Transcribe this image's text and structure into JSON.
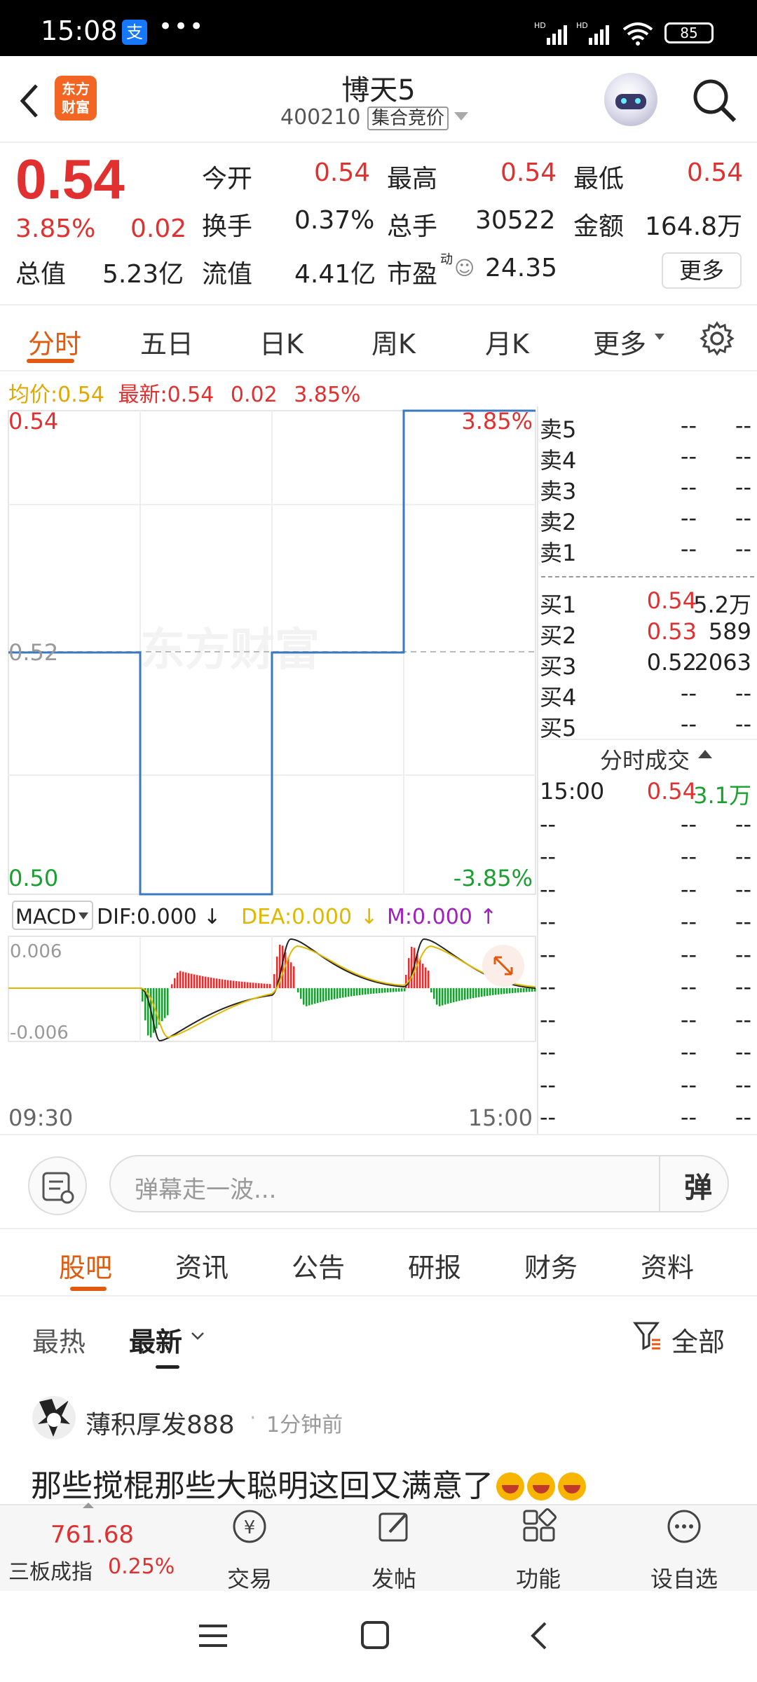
{
  "status_bar": {
    "time": "15:08",
    "app_badge": "支",
    "more": "•••",
    "battery": "85"
  },
  "header": {
    "title": "博天5",
    "code": "400210",
    "tag": "集合竞价",
    "logo_line1": "东方",
    "logo_line2": "财富"
  },
  "quote": {
    "price": "0.54",
    "change_pct": "3.85%",
    "change": "0.02",
    "open_label": "今开",
    "open": "0.54",
    "high_label": "最高",
    "high": "0.54",
    "low_label": "最低",
    "low": "0.54",
    "turnover_label": "换手",
    "turnover": "0.37%",
    "volume_label": "总手",
    "volume": "30522",
    "amount_label": "金额",
    "amount": "164.8万",
    "mktcap_label": "总值",
    "mktcap": "5.23亿",
    "float_label": "流值",
    "float": "4.41亿",
    "pe_label": "市盈",
    "pe_sup": "动",
    "pe": "24.35",
    "more_button": "更多"
  },
  "tabs": [
    "分时",
    "五日",
    "日K",
    "周K",
    "月K",
    "更多"
  ],
  "legend": {
    "avg_label": "均价:",
    "avg": "0.54",
    "last_label": "最新:",
    "last": "0.54",
    "chg": "0.02",
    "pct": "3.85%"
  },
  "chart_labels": {
    "top": "0.54",
    "mid": "0.52",
    "bottom": "0.50",
    "top_pct": "3.85%",
    "bottom_pct": "-3.85%",
    "time_start": "09:30",
    "time_end": "15:00",
    "watermark": "东方财富"
  },
  "macd": {
    "name": "MACD",
    "dif": "DIF:0.000",
    "dea": "DEA:0.000",
    "m": "M:0.000",
    "top": "0.006",
    "bottom": "-0.006"
  },
  "order_book": {
    "asks": [
      {
        "label": "卖5",
        "price": "--",
        "vol": "--"
      },
      {
        "label": "卖4",
        "price": "--",
        "vol": "--"
      },
      {
        "label": "卖3",
        "price": "--",
        "vol": "--"
      },
      {
        "label": "卖2",
        "price": "--",
        "vol": "--"
      },
      {
        "label": "卖1",
        "price": "--",
        "vol": "--"
      }
    ],
    "bids": [
      {
        "label": "买1",
        "price": "0.54",
        "vol": "5.2万"
      },
      {
        "label": "买2",
        "price": "0.53",
        "vol": "589"
      },
      {
        "label": "买3",
        "price": "0.52",
        "vol": "2063"
      },
      {
        "label": "买4",
        "price": "--",
        "vol": "--"
      },
      {
        "label": "买5",
        "price": "--",
        "vol": "--"
      }
    ],
    "trades_title": "分时成交",
    "trades": [
      {
        "time": "15:00",
        "price": "0.54",
        "vol": "3.1万"
      },
      {
        "time": "--",
        "price": "--",
        "vol": "--"
      },
      {
        "time": "--",
        "price": "--",
        "vol": "--"
      },
      {
        "time": "--",
        "price": "--",
        "vol": "--"
      },
      {
        "time": "--",
        "price": "--",
        "vol": "--"
      },
      {
        "time": "--",
        "price": "--",
        "vol": "--"
      },
      {
        "time": "--",
        "price": "--",
        "vol": "--"
      },
      {
        "time": "--",
        "price": "--",
        "vol": "--"
      },
      {
        "time": "--",
        "price": "--",
        "vol": "--"
      },
      {
        "time": "--",
        "price": "--",
        "vol": "--"
      },
      {
        "time": "--",
        "price": "--",
        "vol": "--"
      }
    ]
  },
  "barrage": {
    "placeholder": "弹幕走一波...",
    "button": "弹"
  },
  "sub_tabs": [
    "股吧",
    "资讯",
    "公告",
    "研报",
    "财务",
    "资料"
  ],
  "filters": {
    "hot": "最热",
    "new": "最新",
    "all": "全部"
  },
  "post": {
    "user": "薄积厚发888",
    "time": "1分钟前",
    "text": "那些搅棍那些大聪明这回又满意了"
  },
  "bottom_nav": {
    "index_value": "761.68",
    "index_name": "三板成指",
    "index_pct": "0.25%",
    "trade": "交易",
    "post": "发帖",
    "function": "功能",
    "watchlist": "设自选"
  },
  "chart_data": {
    "type": "line",
    "series": [
      {
        "values": [
          {
            "time": "09:30",
            "price": 0.52
          },
          {
            "time": "10:30",
            "price": 0.52
          },
          {
            "time": "10:30",
            "price": 0.5
          },
          {
            "time": "13:00",
            "price": 0.5
          },
          {
            "time": "13:00",
            "price": 0.52
          },
          {
            "time": "14:00",
            "price": 0.52
          },
          {
            "time": "14:00",
            "price": 0.54
          },
          {
            "time": "15:00",
            "price": 0.54
          }
        ]
      }
    ],
    "ylim": [
      0.5,
      0.54
    ],
    "reference": 0.52,
    "macd_ylim": [
      -0.006,
      0.006
    ]
  },
  "colors": {
    "up": "#e03030",
    "down": "#1aa030",
    "accent": "#e05a10",
    "line": "#3a78c0",
    "dea": "#e0b800",
    "m": "#a020c0"
  }
}
